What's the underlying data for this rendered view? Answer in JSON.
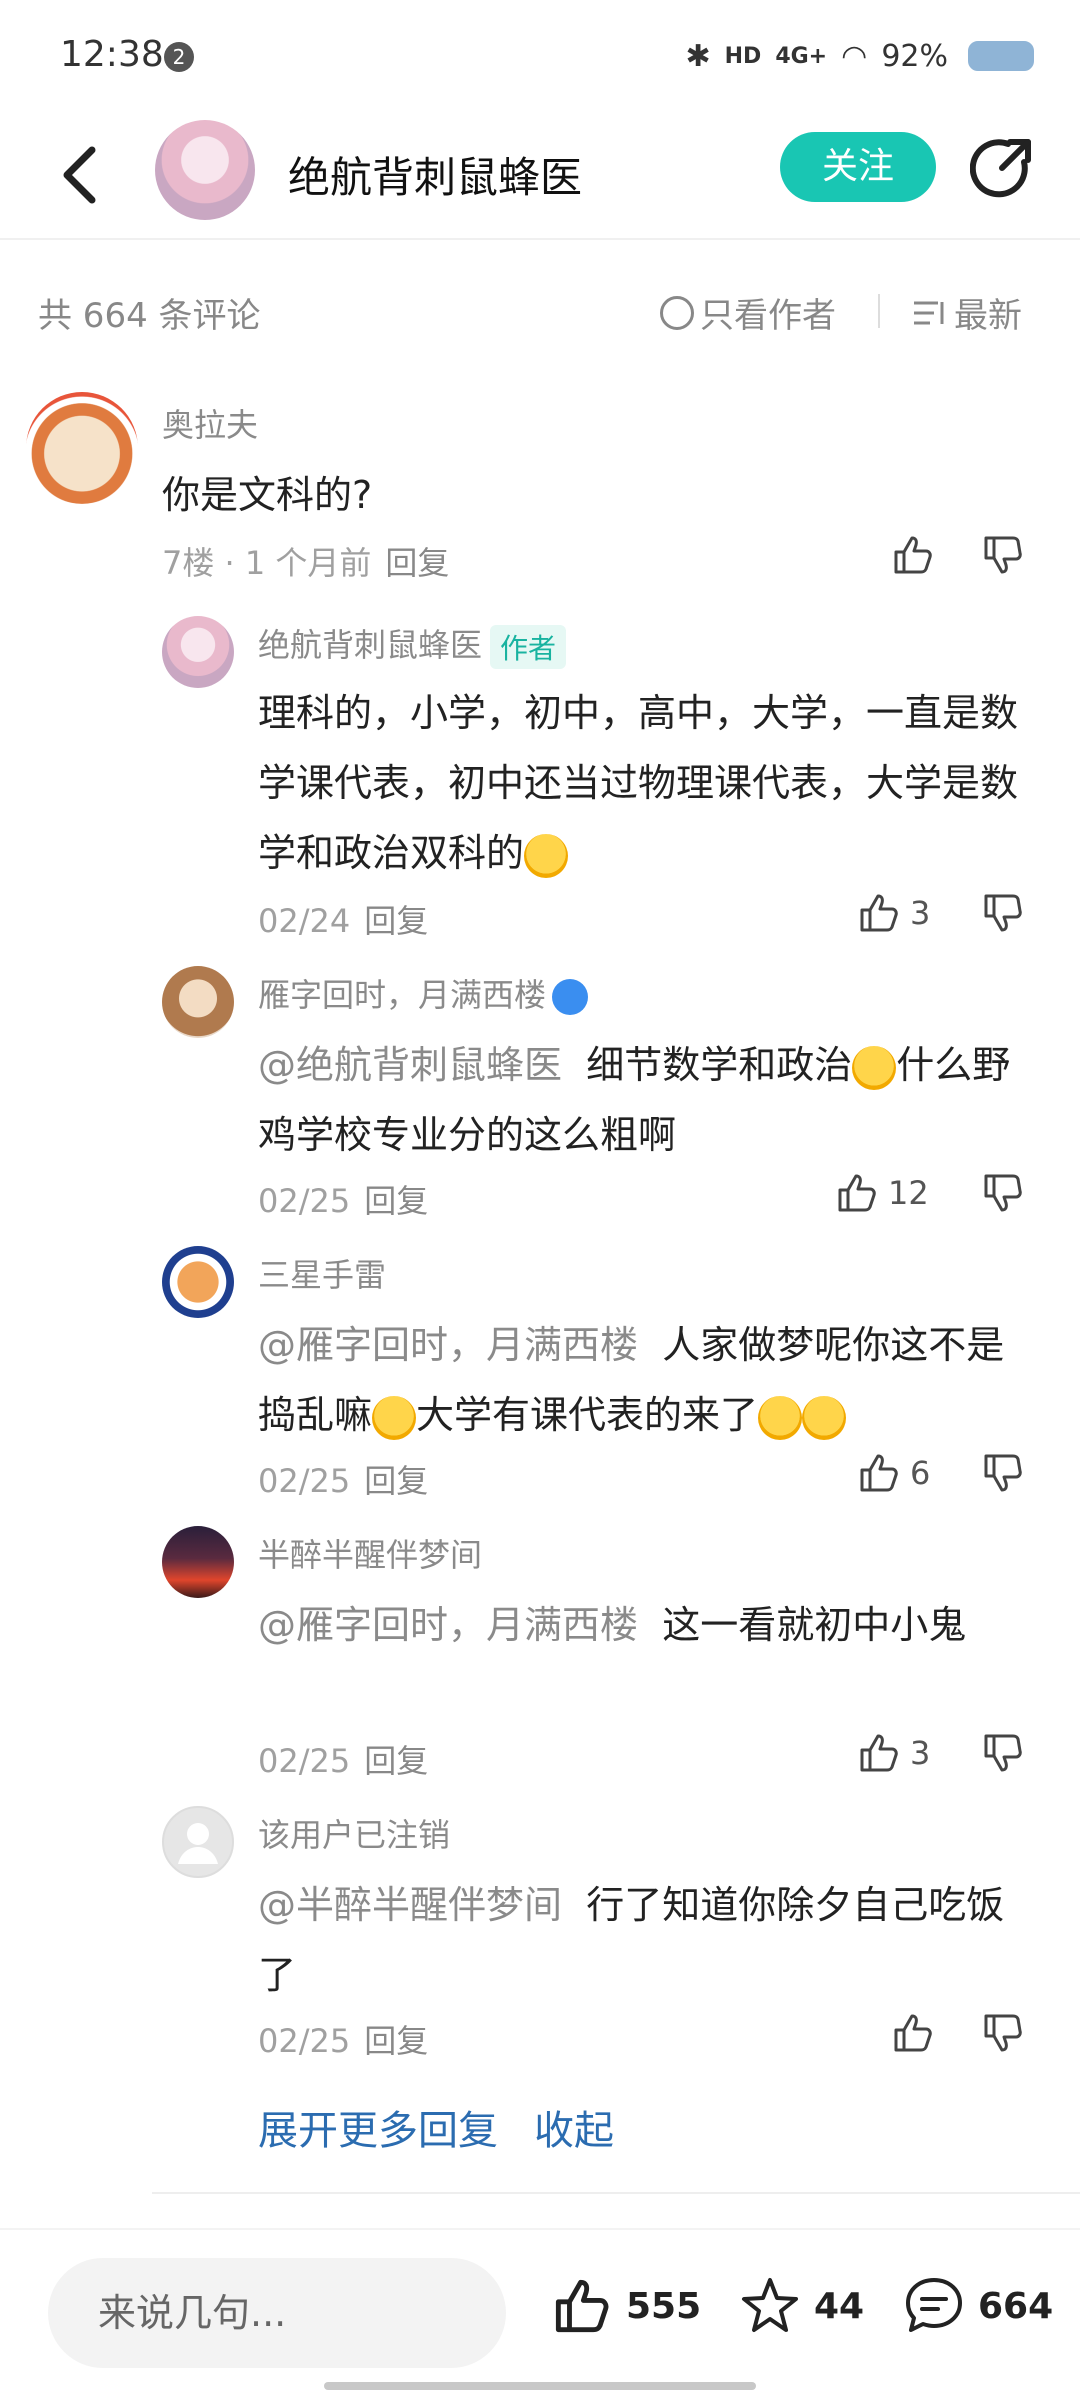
{
  "status_bar": {
    "time": "12:38",
    "notification_count": "2",
    "network": "4G+",
    "battery": "92%"
  },
  "header": {
    "title": "绝航背刺鼠蜂医",
    "follow_label": "关注"
  },
  "sort_bar": {
    "count_text": "共 664 条评论",
    "only_author_label": "只看作者",
    "sort_label": "最新"
  },
  "main_comment": {
    "user": "奥拉夫",
    "text": "你是文科的?",
    "meta": "7楼 · 1 个月前",
    "reply_label": "回复"
  },
  "replies": [
    {
      "user": "绝航背刺鼠蜂医",
      "tag": "作者",
      "text": "理科的，小学，初中，高中，大学，一直是数学课代表，初中还当过物理课代表，大学是数学和政治双科的",
      "date": "02/24",
      "reply_label": "回复",
      "likes": "3"
    },
    {
      "user": "雁字回时，月满西楼",
      "mention": "@绝航背刺鼠蜂医",
      "text1": "细节数学和政治",
      "text2": "什么野鸡学校专业分的这么粗啊",
      "date": "02/25",
      "reply_label": "回复",
      "likes": "12"
    },
    {
      "user": "三星手雷",
      "mention": "@雁字回时，月满西楼",
      "text1": "人家做梦呢你这不是捣乱嘛",
      "text2": "大学有课代表的来了",
      "date": "02/25",
      "reply_label": "回复",
      "likes": "6"
    },
    {
      "user": "半醉半醒伴梦间",
      "mention": "@雁字回时，月满西楼",
      "text": "这一看就初中小鬼",
      "date": "02/25",
      "reply_label": "回复",
      "likes": "3"
    },
    {
      "user": "该用户已注销",
      "mention": "@半醉半醒伴梦间",
      "text": "行了知道你除夕自己吃饭了",
      "date": "02/25",
      "reply_label": "回复"
    }
  ],
  "more": {
    "expand_label": "展开更多回复",
    "collapse_label": "收起"
  },
  "bottom_bar": {
    "input_placeholder": "来说几句...",
    "likes": "555",
    "favorites": "44",
    "comments": "664"
  },
  "colors": {
    "accent": "#19c6b3",
    "link": "#2b6cb0"
  }
}
